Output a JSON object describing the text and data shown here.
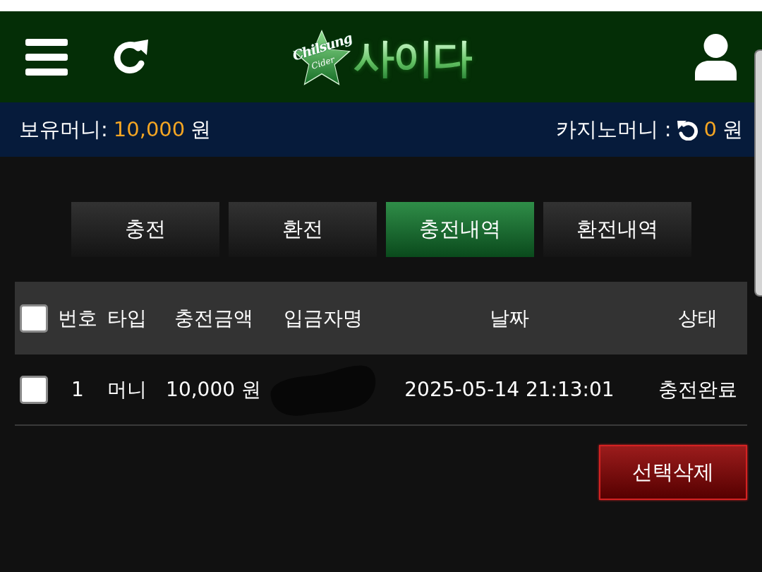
{
  "header": {
    "logo": {
      "script": "Chilsung",
      "sub": "Cider",
      "title": "사이다"
    }
  },
  "balance_bar": {
    "money": {
      "label": "보유머니:",
      "amount": "10,000",
      "unit": "원"
    },
    "casino": {
      "label": "카지노머니 :",
      "amount": "0",
      "unit": "원"
    }
  },
  "tabs": [
    {
      "label": "충전",
      "selected": false
    },
    {
      "label": "환전",
      "selected": false
    },
    {
      "label": "충전내역",
      "selected": true
    },
    {
      "label": "환전내역",
      "selected": false
    }
  ],
  "table": {
    "select_all": {
      "checked": false
    },
    "columns": [
      "번호",
      "타입",
      "충전금액",
      "입금자명",
      "날짜",
      "상태"
    ],
    "rows": [
      {
        "checked": false,
        "number": "1",
        "type": "머니",
        "amount": "10,000 원",
        "depositor_redacted": true,
        "date": "2025-05-14 21:13:01",
        "status": "충전완료"
      }
    ]
  },
  "delete_button": {
    "label": "선택삭제"
  }
}
